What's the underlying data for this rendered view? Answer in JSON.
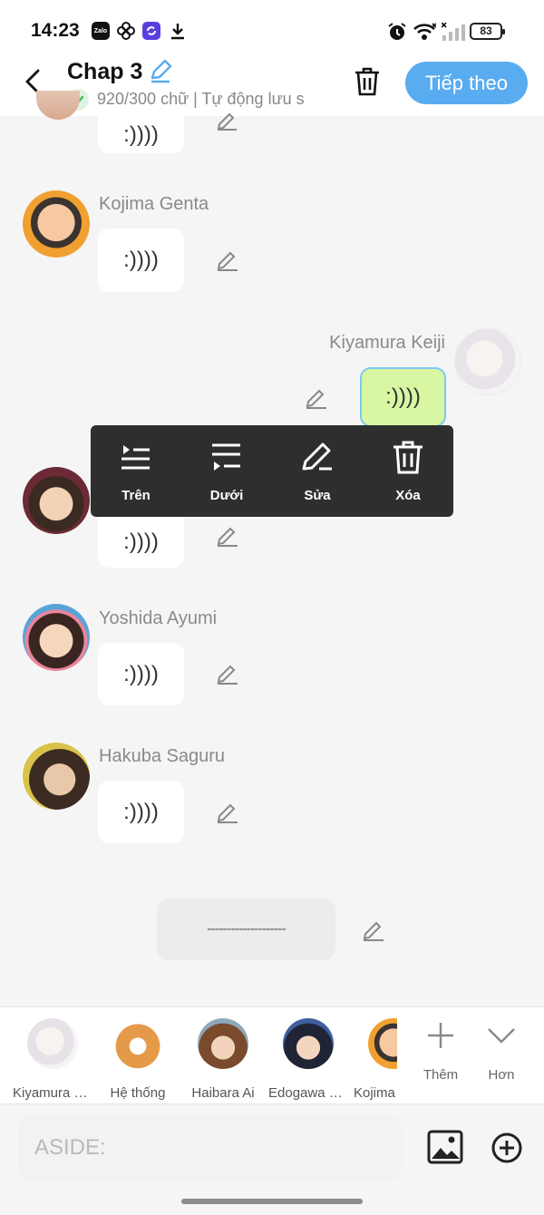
{
  "status_bar": {
    "time": "14:23",
    "battery": "83",
    "app_icons": [
      "zalo-icon",
      "flower-icon",
      "sync-app-icon",
      "download-icon"
    ],
    "system_icons": [
      "alarm-icon",
      "wifi-icon",
      "signal-icon",
      "battery-icon"
    ]
  },
  "header": {
    "title": "Chap 3",
    "status": "920/300 chữ | Tự động lưu s",
    "next_button": "Tiếp theo",
    "accent_color": "#5aacf0"
  },
  "messages": [
    {
      "speaker": "",
      "text": ":))))",
      "side": "left",
      "avatar": "partial-avatar"
    },
    {
      "speaker": "Kojima Genta",
      "text": ":))))",
      "side": "left"
    },
    {
      "speaker": "Kiyamura Keiji",
      "text": ":))))",
      "side": "right",
      "selected": true
    },
    {
      "speaker": "",
      "text": ":))))",
      "side": "left"
    },
    {
      "speaker": "Yoshida Ayumi",
      "text": ":))))",
      "side": "left"
    },
    {
      "speaker": "Hakuba Saguru",
      "text": ":))))",
      "side": "left"
    }
  ],
  "context_menu": [
    {
      "label": "Trên",
      "icon": "insert-above-icon"
    },
    {
      "label": "Dưới",
      "icon": "insert-below-icon"
    },
    {
      "label": "Sửa",
      "icon": "edit-icon"
    },
    {
      "label": "Xóa",
      "icon": "delete-icon"
    }
  ],
  "separator": {
    "text": "--------------------"
  },
  "characters": [
    {
      "name": "Kiyamura Keiji"
    },
    {
      "name": "Hệ thống"
    },
    {
      "name": "Haibara Ai"
    },
    {
      "name": "Edogawa Conan"
    },
    {
      "name": "Kojima Genta"
    }
  ],
  "bar_buttons": {
    "add": "Thêm",
    "more": "Hơn"
  },
  "input": {
    "placeholder": "ASIDE:",
    "value": ""
  }
}
